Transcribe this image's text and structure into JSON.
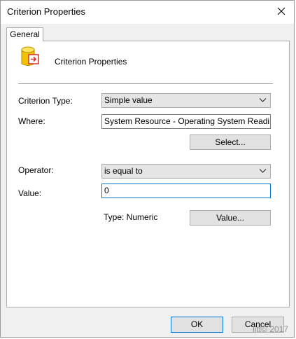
{
  "window": {
    "title": "Criterion Properties",
    "close_icon": "close-icon"
  },
  "tabs": [
    {
      "label": "General",
      "active": true
    }
  ],
  "header": {
    "icon": "database-arrow-icon",
    "label": "Criterion Properties"
  },
  "form": {
    "criterion_type_label": "Criterion Type:",
    "criterion_type_value": "Simple value",
    "where_label": "Where:",
    "where_value": "System Resource - Operating System Readiness",
    "select_button": "Select...",
    "operator_label": "Operator:",
    "operator_value": "is equal to",
    "value_label": "Value:",
    "value_value": "0",
    "type_text": "Type: Numeric",
    "value_button": "Value..."
  },
  "footer": {
    "ok": "OK",
    "cancel": "Cancel"
  },
  "watermark": "litt© 2017",
  "colors": {
    "focus_border": "#0078d7",
    "dialog_bg": "#f0f0f0",
    "icon_yellow": "#f2c200",
    "icon_red": "#d9302c"
  }
}
